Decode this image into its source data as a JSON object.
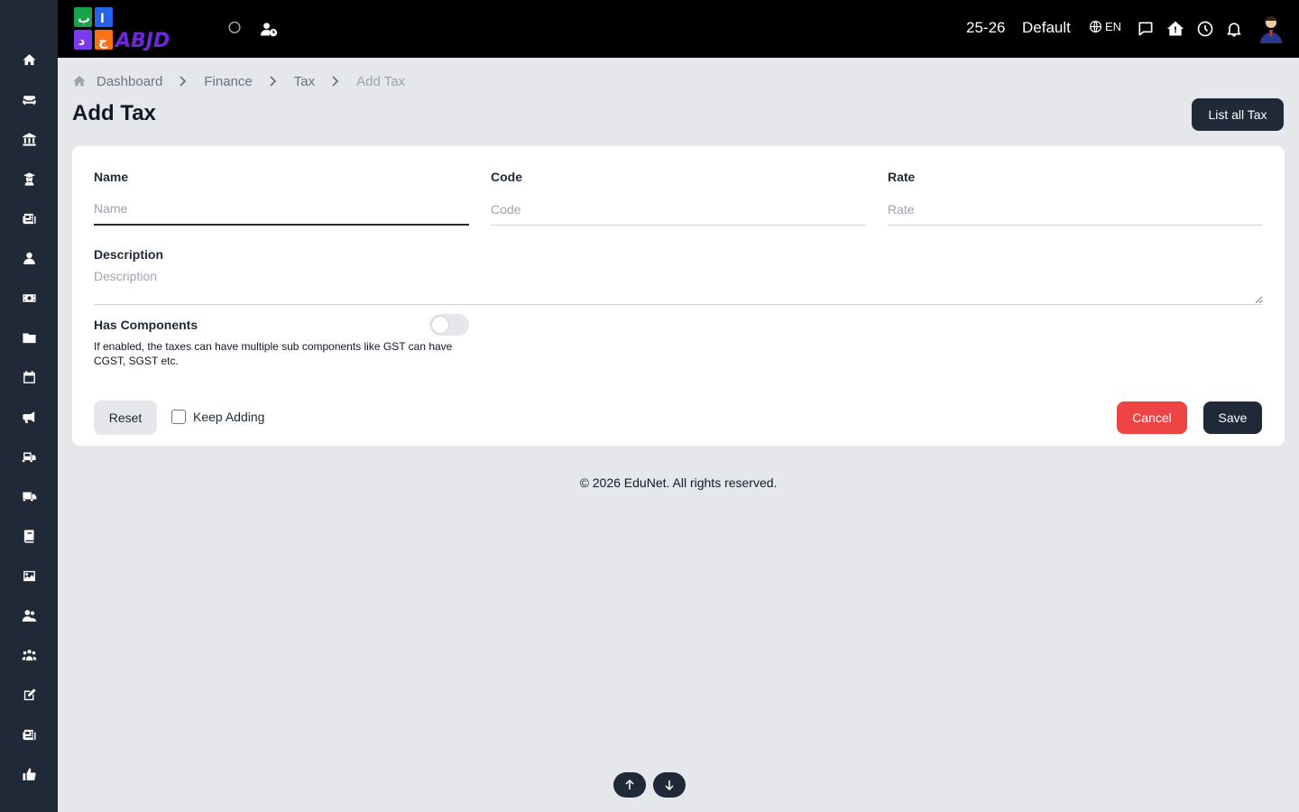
{
  "sidebar": {
    "items": [
      {
        "icon": "home-icon"
      },
      {
        "icon": "sofa-icon"
      },
      {
        "icon": "bank-icon"
      },
      {
        "icon": "graduate-icon"
      },
      {
        "icon": "newspaper-icon"
      },
      {
        "icon": "user-icon"
      },
      {
        "icon": "money-icon"
      },
      {
        "icon": "folder-icon"
      },
      {
        "icon": "calendar-icon"
      },
      {
        "icon": "megaphone-icon"
      },
      {
        "icon": "school-bus-icon"
      },
      {
        "icon": "truck-icon"
      },
      {
        "icon": "book-icon"
      },
      {
        "icon": "image-icon"
      },
      {
        "icon": "users-icon"
      },
      {
        "icon": "people-group-icon"
      },
      {
        "icon": "edit-icon"
      },
      {
        "icon": "list-icon"
      },
      {
        "icon": "thumbs-up-icon"
      }
    ]
  },
  "topbar": {
    "session": "25-26",
    "school": "Default",
    "language": "EN"
  },
  "breadcrumb": {
    "items": [
      "Dashboard",
      "Finance",
      "Tax"
    ],
    "current": "Add Tax"
  },
  "page": {
    "title": "Add Tax",
    "list_button": "List all Tax"
  },
  "form": {
    "name": {
      "label": "Name",
      "placeholder": "Name",
      "value": ""
    },
    "code": {
      "label": "Code",
      "placeholder": "Code",
      "value": ""
    },
    "rate": {
      "label": "Rate",
      "placeholder": "Rate",
      "value": ""
    },
    "description": {
      "label": "Description",
      "placeholder": "Description",
      "value": ""
    },
    "has_components": {
      "label": "Has Components",
      "help": "If enabled, the taxes can have multiple sub components like GST can have CGST, SGST etc.",
      "enabled": false
    },
    "keep_adding": {
      "label": "Keep Adding",
      "checked": false
    },
    "reset_label": "Reset",
    "cancel_label": "Cancel",
    "save_label": "Save"
  },
  "footer": {
    "text": "© 2026 EduNet. All rights reserved."
  },
  "colors": {
    "sidebar": "#1f2937",
    "topbar": "#000000",
    "page_bg": "#e5e7eb",
    "primary": "#1f2937",
    "danger": "#ef4444"
  }
}
